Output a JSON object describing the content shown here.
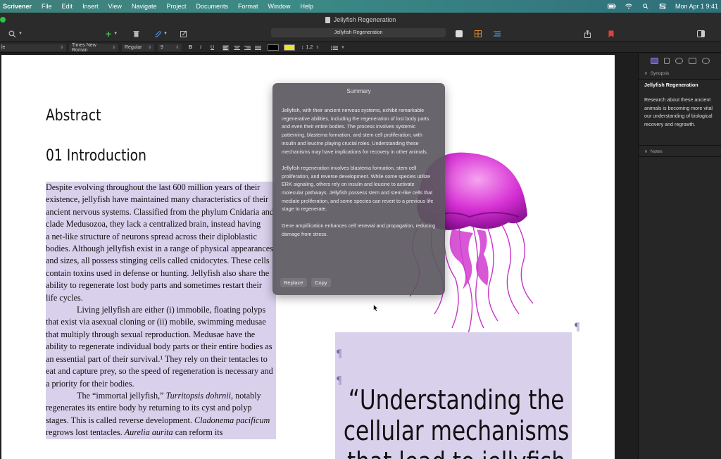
{
  "menubar": {
    "app": "Scrivener",
    "items": [
      "File",
      "Edit",
      "Insert",
      "View",
      "Navigate",
      "Project",
      "Documents",
      "Format",
      "Window",
      "Help"
    ],
    "clock": "Mon Apr 1  9:41"
  },
  "window": {
    "title": "Jellyfish Regeneration"
  },
  "toolbar": {
    "search_value": "Jellyfish Regeneration"
  },
  "formatbar": {
    "style": "le",
    "font": "Times New Roman",
    "weight": "Regular",
    "size": "9",
    "bold": "B",
    "italic": "I",
    "underline": "U",
    "line_spacing": "1.2"
  },
  "document": {
    "heading_abstract": "Abstract",
    "heading_intro": "01 Introduction",
    "paragraphs": [
      "Despite evolving throughout the last 600 million years of their existence, jellyfish have maintained many characteristics of their ancient nervous systems. Classified from the phylum Cnidaria and clade Medusozoa, they lack a centralized brain, instead having",
      "a net-like structure of neurons spread across their diploblastic bodies. Although jellyfish exist in a range of physical appearances and sizes, all possess stinging cells called cnidocytes. These cells contain toxins used in defense or hunting. Jellyfish also share the ability to regenerate lost body parts and sometimes restart their",
      "life cycles.",
      "Living jellyfish are either (i) immobile, floating polyps that exist via asexual cloning or (ii) mobile, swimming medusae that multiply through sexual reproduction. Medusae have the ability to regenerate individual body parts or their entire bodies as an essential part of their survival.¹ They rely on their tentacles to eat and capture prey, so the speed of regeneration is necessary and a priority for their bodies."
    ],
    "p5_a": "The “immortal jellyfish,” ",
    "p5_em1": "Turritopsis dohrnii",
    "p5_b": ", notably regenerates its entire body by returning to its cyst and polyp stages. This is called reverse development. ",
    "p5_em2": "Cladonema pacificum",
    "p5_c": " regrows lost tentacles. ",
    "p5_em3": "Aurelia aurita",
    "p5_d": " can reform its",
    "quote": "“Understanding the cellular mechanisms that lead to jellyfish",
    "pilcrow": "¶"
  },
  "summary": {
    "title": "Summary",
    "paragraphs": [
      "Jellyfish, with their ancient nervous systems, exhibit remarkable regenerative abilities, including the regeneration of lost body parts and even their entire bodies. The process involves systemic patterning, blastema formation, and stem cell proliferation, with insulin and leucine playing crucial roles. Understanding these mechanisms may have implications for recovery in other animals.",
      "Jellyfish regeneration involves blastema formation, stem cell proliferation, and reverse development. While some species utilize ERK signaling, others rely on insulin and leucine to activate molecular pathways. Jellyfish possess stem and stem-like cells that mediate proliferation, and some species can revert to a previous life stage to regenerate.",
      "Gene amplification enhances cell renewal and propagation, reducing damage from stress."
    ],
    "replace_label": "Replace",
    "copy_label": "Copy"
  },
  "inspector": {
    "synopsis_label": "Synopsis",
    "synopsis_title": "Jellyfish Regeneration",
    "synopsis_lines": [
      "Research about these ancient",
      "animals is becoming more vital",
      "our understanding of biological",
      "recovery and regrowth."
    ],
    "notes_label": "Notes"
  },
  "colors": {
    "highlight": "#d9d0ec",
    "jelly": "#c21fc7",
    "accent": "#5a4f92"
  }
}
